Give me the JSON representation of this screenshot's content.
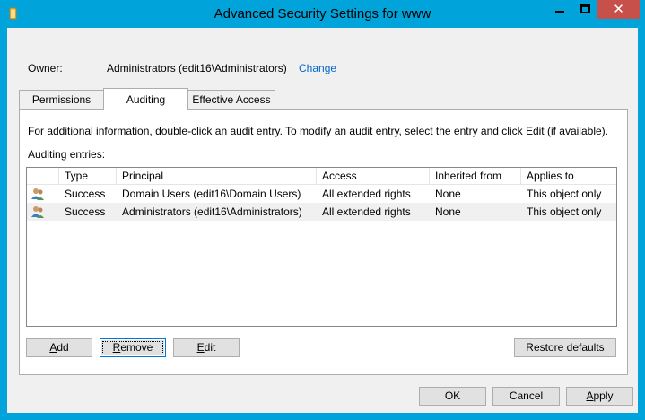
{
  "colors": {
    "frame": "#00a3da",
    "client": "#f0f0f0",
    "link": "#0066cc",
    "close_bg": "#c7504b"
  },
  "window": {
    "title": "Advanced Security Settings for www",
    "icon": "folder-icon",
    "controls": {
      "minimize": "minimize-icon",
      "maximize": "maximize-icon",
      "close": "✕"
    }
  },
  "owner": {
    "label": "Owner:",
    "value": "Administrators (edit16\\Administrators)",
    "change_link": "Change"
  },
  "tabs": [
    {
      "label": "Permissions",
      "active": false
    },
    {
      "label": "Auditing",
      "active": true
    },
    {
      "label": "Effective Access",
      "active": false
    }
  ],
  "auditing": {
    "info": "For additional information, double-click an audit entry. To modify an audit entry, select the entry and click Edit (if available).",
    "entries_label": "Auditing entries:",
    "columns": [
      "",
      "Type",
      "Principal",
      "Access",
      "Inherited from",
      "Applies to"
    ],
    "rows": [
      {
        "icon": "user-group-icon",
        "type": "Success",
        "principal": "Domain Users (edit16\\Domain Users)",
        "access": "All extended rights",
        "inherited_from": "None",
        "applies_to": "This object only",
        "selected": false
      },
      {
        "icon": "user-group-icon",
        "type": "Success",
        "principal": "Administrators (edit16\\Administrators)",
        "access": "All extended rights",
        "inherited_from": "None",
        "applies_to": "This object only",
        "selected": true
      }
    ]
  },
  "buttons": {
    "add": {
      "prefix": "",
      "accel": "A",
      "rest": "dd"
    },
    "remove": {
      "prefix": "",
      "accel": "R",
      "rest": "emove"
    },
    "edit": {
      "prefix": "",
      "accel": "E",
      "rest": "dit"
    },
    "restore_defaults": "Restore defaults",
    "ok": "OK",
    "cancel": "Cancel",
    "apply": {
      "prefix": "",
      "accel": "A",
      "rest": "pply"
    }
  }
}
